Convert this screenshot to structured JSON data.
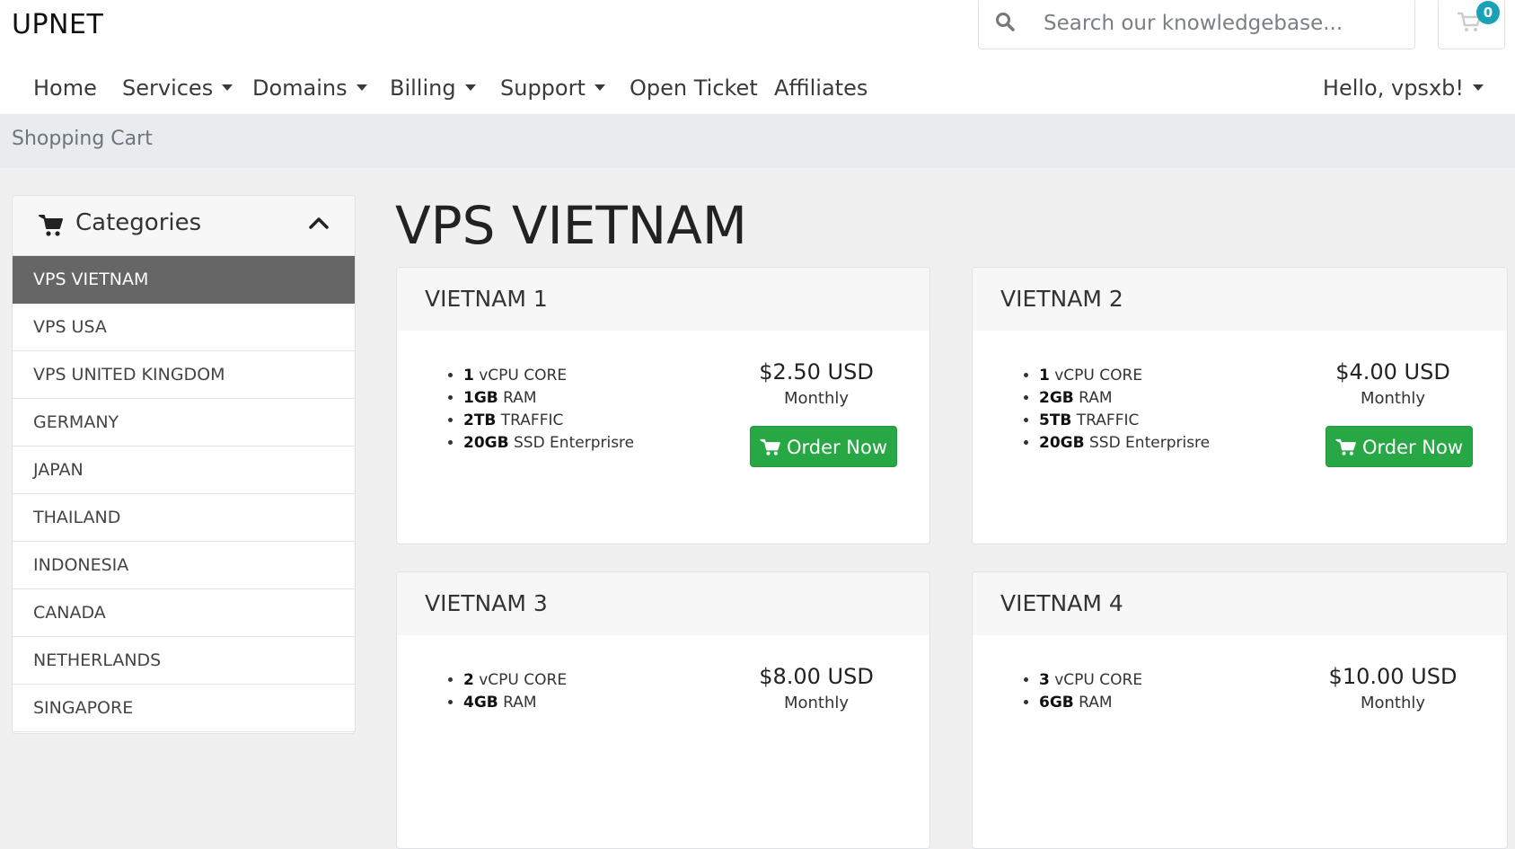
{
  "brand": "UPNET",
  "search": {
    "placeholder": "Search our knowledgebase..."
  },
  "cart": {
    "count": "0"
  },
  "nav": {
    "home": "Home",
    "services": "Services",
    "domains": "Domains",
    "billing": "Billing",
    "support": "Support",
    "open_ticket": "Open Ticket",
    "affiliates": "Affiliates",
    "user": "Hello, vpsxb!"
  },
  "breadcrumb": "Shopping Cart",
  "sidebar": {
    "title": "Categories",
    "items": [
      {
        "label": "VPS VIETNAM",
        "active": true
      },
      {
        "label": "VPS USA"
      },
      {
        "label": "VPS UNITED KINGDOM"
      },
      {
        "label": "GERMANY"
      },
      {
        "label": "JAPAN"
      },
      {
        "label": "THAILAND"
      },
      {
        "label": "INDONESIA"
      },
      {
        "label": "CANADA"
      },
      {
        "label": "NETHERLANDS"
      },
      {
        "label": "SINGAPORE"
      }
    ]
  },
  "page_title": "VPS VIETNAM",
  "order_label": "Order Now",
  "products": [
    {
      "name": "VIETNAM 1",
      "price": "$2.50 USD",
      "cycle": "Monthly",
      "features": [
        {
          "value": "1",
          "label": " vCPU CORE"
        },
        {
          "value": "1GB",
          "label": " RAM"
        },
        {
          "value": "2TB",
          "label": " TRAFFIC"
        },
        {
          "value": "20GB",
          "label": " SSD Enterprisre"
        }
      ]
    },
    {
      "name": "VIETNAM 2",
      "price": "$4.00 USD",
      "cycle": "Monthly",
      "features": [
        {
          "value": "1",
          "label": " vCPU CORE"
        },
        {
          "value": "2GB",
          "label": " RAM"
        },
        {
          "value": "5TB",
          "label": " TRAFFIC"
        },
        {
          "value": "20GB",
          "label": " SSD Enterprisre"
        }
      ]
    },
    {
      "name": "VIETNAM 3",
      "price": "$8.00 USD",
      "cycle": "Monthly",
      "features": [
        {
          "value": "2",
          "label": " vCPU CORE"
        },
        {
          "value": "4GB",
          "label": " RAM"
        }
      ]
    },
    {
      "name": "VIETNAM 4",
      "price": "$10.00 USD",
      "cycle": "Monthly",
      "features": [
        {
          "value": "3",
          "label": " vCPU CORE"
        },
        {
          "value": "6GB",
          "label": " RAM"
        }
      ]
    }
  ],
  "colors": {
    "accent_green": "#28a745",
    "badge_teal": "#17a2b8",
    "active_category": "#666666"
  }
}
